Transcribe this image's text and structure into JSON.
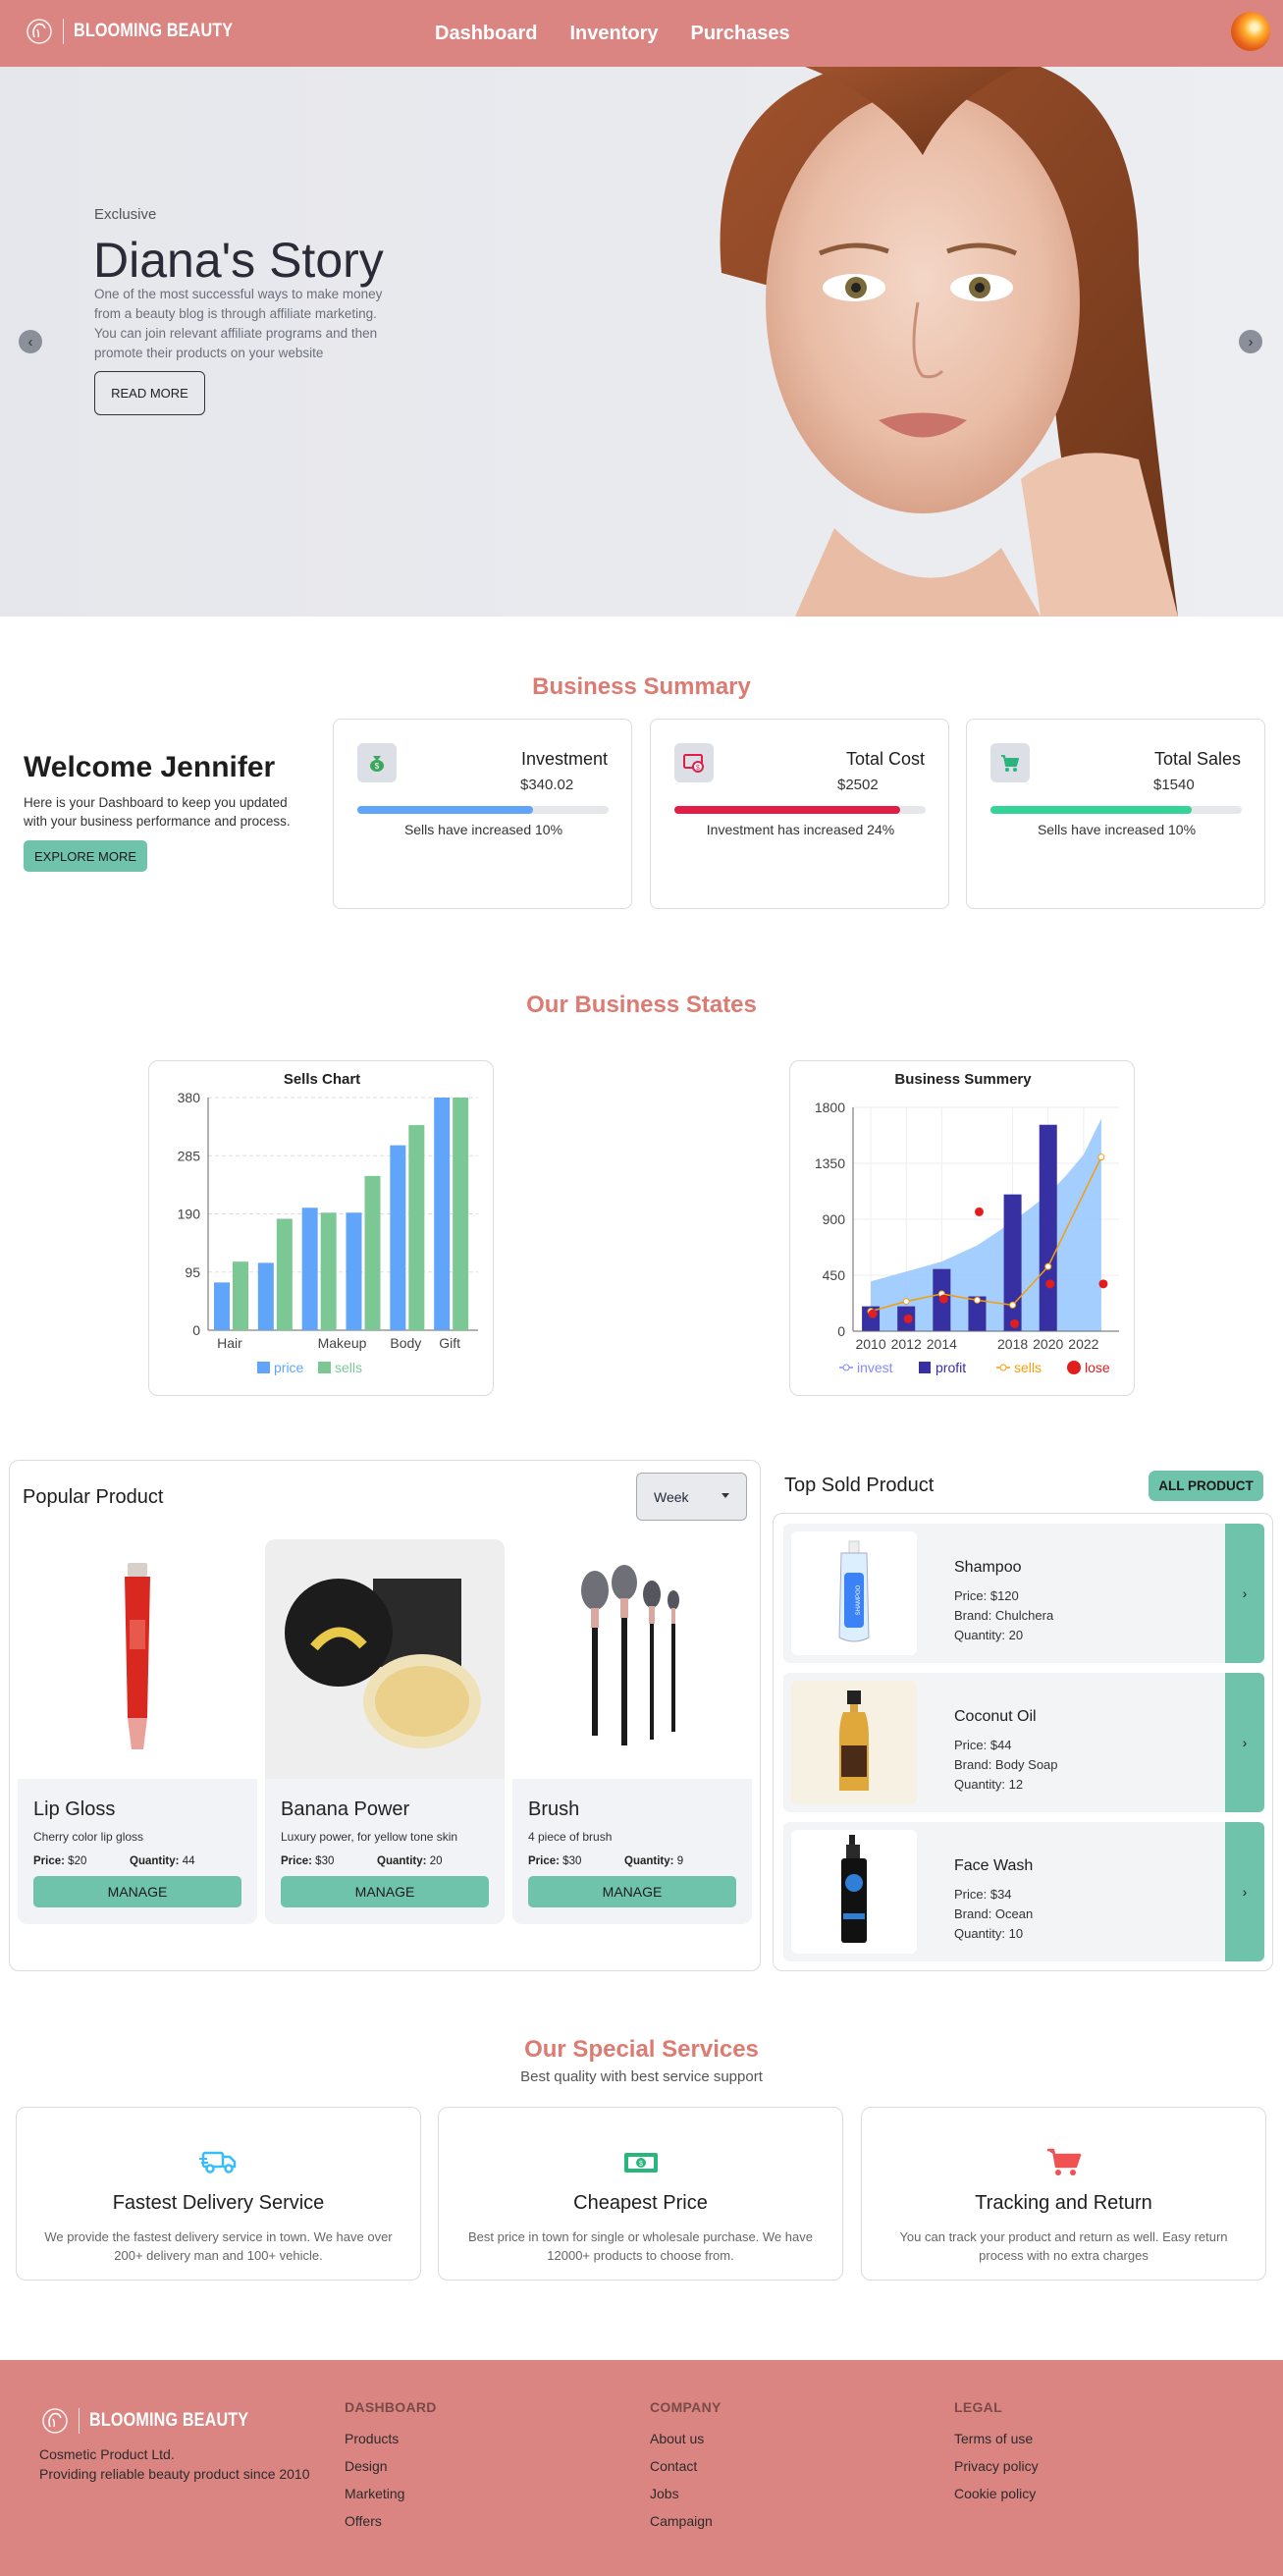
{
  "nav": {
    "brand": "BLOOMING BEAUTY",
    "links": [
      "Dashboard",
      "Inventory",
      "Purchases"
    ]
  },
  "hero": {
    "eyebrow": "Exclusive",
    "title": "Diana's Story",
    "text": "One of the most successful ways to make money from a beauty blog is through affiliate marketing. You can join relevant affiliate programs and then promote their products on your website",
    "button": "READ MORE",
    "prev_icon": "chevron-left-icon",
    "next_icon": "chevron-right-icon"
  },
  "summary": {
    "title": "Business Summary",
    "welcome_title": "Welcome Jennifer",
    "welcome_text": "Here is your Dashboard to keep you updated with your business performance and process.",
    "welcome_button": "EXPLORE MORE",
    "cards": [
      {
        "title": "Investment",
        "value": "$340.02",
        "note": "Sells have increased 10%",
        "progress": 0.7,
        "color": "#60a5fa",
        "icon": "money-bag-icon"
      },
      {
        "title": "Total Cost",
        "value": "$2502",
        "note": "Investment has increased 24%",
        "progress": 0.9,
        "color": "#e11d48",
        "icon": "receipt-icon"
      },
      {
        "title": "Total Sales",
        "value": "$1540",
        "note": "Sells have increased 10%",
        "progress": 0.8,
        "color": "#34d399",
        "icon": "cart-icon"
      }
    ]
  },
  "states": {
    "title": "Our Business States"
  },
  "chart_data": [
    {
      "type": "bar",
      "title": "Sells Chart",
      "categories": [
        "Hair",
        "",
        "Makeup",
        "",
        "Body",
        "Gift"
      ],
      "x_tick_labels": [
        "Hair",
        "Makeup",
        "Body",
        "Gift"
      ],
      "series": [
        {
          "name": "price",
          "color": "#60a5fa",
          "values": [
            78,
            110,
            200,
            192,
            302,
            380
          ]
        },
        {
          "name": "sells",
          "color": "#7cc894",
          "values": [
            112,
            182,
            192,
            252,
            335,
            380
          ]
        }
      ],
      "yticks": [
        0,
        95,
        190,
        285,
        380
      ],
      "ylim": [
        0,
        380
      ],
      "grid": true,
      "legend": "bottom"
    },
    {
      "type": "bar",
      "title": "Business Summery",
      "x": [
        2010,
        2011,
        2012,
        2013,
        2014,
        2015,
        2016,
        2017,
        2018,
        2019,
        2020,
        2021,
        2022,
        2023
      ],
      "xticks": [
        2010,
        2012,
        2014,
        2018,
        2020,
        2022
      ],
      "series": [
        {
          "name": "invest",
          "type": "area",
          "color": "#93c5fd",
          "points": [
            [
              2010,
              400
            ],
            [
              2012,
              480
            ],
            [
              2014,
              560
            ],
            [
              2016,
              690
            ],
            [
              2018,
              880
            ],
            [
              2020,
              1100
            ],
            [
              2021,
              1250
            ],
            [
              2022,
              1420
            ],
            [
              2023,
              1710
            ]
          ]
        },
        {
          "name": "profit",
          "type": "bar",
          "color": "#3730a3",
          "points": [
            [
              2010,
              200
            ],
            [
              2012,
              200
            ],
            [
              2014,
              500
            ],
            [
              2016,
              280
            ],
            [
              2018,
              1100
            ],
            [
              2020,
              1660
            ]
          ]
        },
        {
          "name": "sells",
          "type": "line",
          "color": "#f59e0b",
          "points": [
            [
              2010,
              160
            ],
            [
              2012,
              240
            ],
            [
              2014,
              300
            ],
            [
              2016,
              250
            ],
            [
              2018,
              210
            ],
            [
              2020,
              520
            ],
            [
              2023,
              1400
            ]
          ]
        },
        {
          "name": "lose",
          "type": "scatter",
          "color": "#e11d1d",
          "points": [
            [
              2010,
              140
            ],
            [
              2012,
              100
            ],
            [
              2014,
              260
            ],
            [
              2016,
              960
            ],
            [
              2018,
              60
            ],
            [
              2020,
              380
            ],
            [
              2023,
              380
            ]
          ]
        }
      ],
      "yticks": [
        0,
        450,
        900,
        1350,
        1800
      ],
      "ylim": [
        0,
        1800
      ],
      "grid": true,
      "legend": "bottom"
    }
  ],
  "popular": {
    "title": "Popular Product",
    "select_value": "Week",
    "products": [
      {
        "name": "Lip Gloss",
        "desc": "Cherry color lip gloss",
        "price": "$20",
        "quantity": "44",
        "button": "MANAGE",
        "icon": "lip-gloss-icon"
      },
      {
        "name": "Banana Power",
        "desc": "Luxury power, for yellow tone skin",
        "price": "$30",
        "quantity": "20",
        "button": "MANAGE",
        "icon": "powder-jar-icon"
      },
      {
        "name": "Brush",
        "desc": "4 piece of brush",
        "price": "$30",
        "quantity": "9",
        "button": "MANAGE",
        "icon": "makeup-brush-icon"
      }
    ],
    "price_label": "Price:",
    "quantity_label": "Quantity:"
  },
  "top_sold": {
    "title": "Top Sold Product",
    "button": "ALL PRODUCT",
    "items": [
      {
        "name": "Shampoo",
        "price": "Price: $120",
        "brand": "Brand: Chulchera",
        "quantity": "Quantity: 20",
        "icon": "shampoo-bottle-icon"
      },
      {
        "name": "Coconut Oil",
        "price": "Price: $44",
        "brand": "Brand: Body Soap",
        "quantity": "Quantity: 12",
        "icon": "oil-bottle-icon"
      },
      {
        "name": "Face Wash",
        "price": "Price: $34",
        "brand": "Brand: Ocean",
        "quantity": "Quantity: 10",
        "icon": "face-wash-bottle-icon"
      }
    ]
  },
  "services": {
    "title": "Our Special Services",
    "subtitle": "Best quality with best service support",
    "items": [
      {
        "title": "Fastest Delivery Service",
        "text": "We provide the fastest delivery service in town. We have over 200+ delivery man and 100+ vehicle.",
        "icon": "truck-icon",
        "color": "#38bdf8"
      },
      {
        "title": "Cheapest Price",
        "text": "Best price in town for single or wholesale purchase. We have 12000+ products to choose from.",
        "icon": "money-bill-icon",
        "color": "#2bb57e"
      },
      {
        "title": "Tracking and Return",
        "text": "You can track your product and return as well. Easy return process with no extra charges",
        "icon": "cart-icon",
        "color": "#f05252"
      }
    ]
  },
  "footer": {
    "brand": "BLOOMING BEAUTY",
    "company": "Cosmetic Product Ltd.",
    "tagline": "Providing reliable beauty product since 2010",
    "columns": [
      {
        "head": "DASHBOARD",
        "items": [
          "Products",
          "Design",
          "Marketing",
          "Offers"
        ]
      },
      {
        "head": "COMPANY",
        "items": [
          "About us",
          "Contact",
          "Jobs",
          "Campaign"
        ]
      },
      {
        "head": "LEGAL",
        "items": [
          "Terms of use",
          "Privacy policy",
          "Cookie policy"
        ]
      }
    ]
  }
}
